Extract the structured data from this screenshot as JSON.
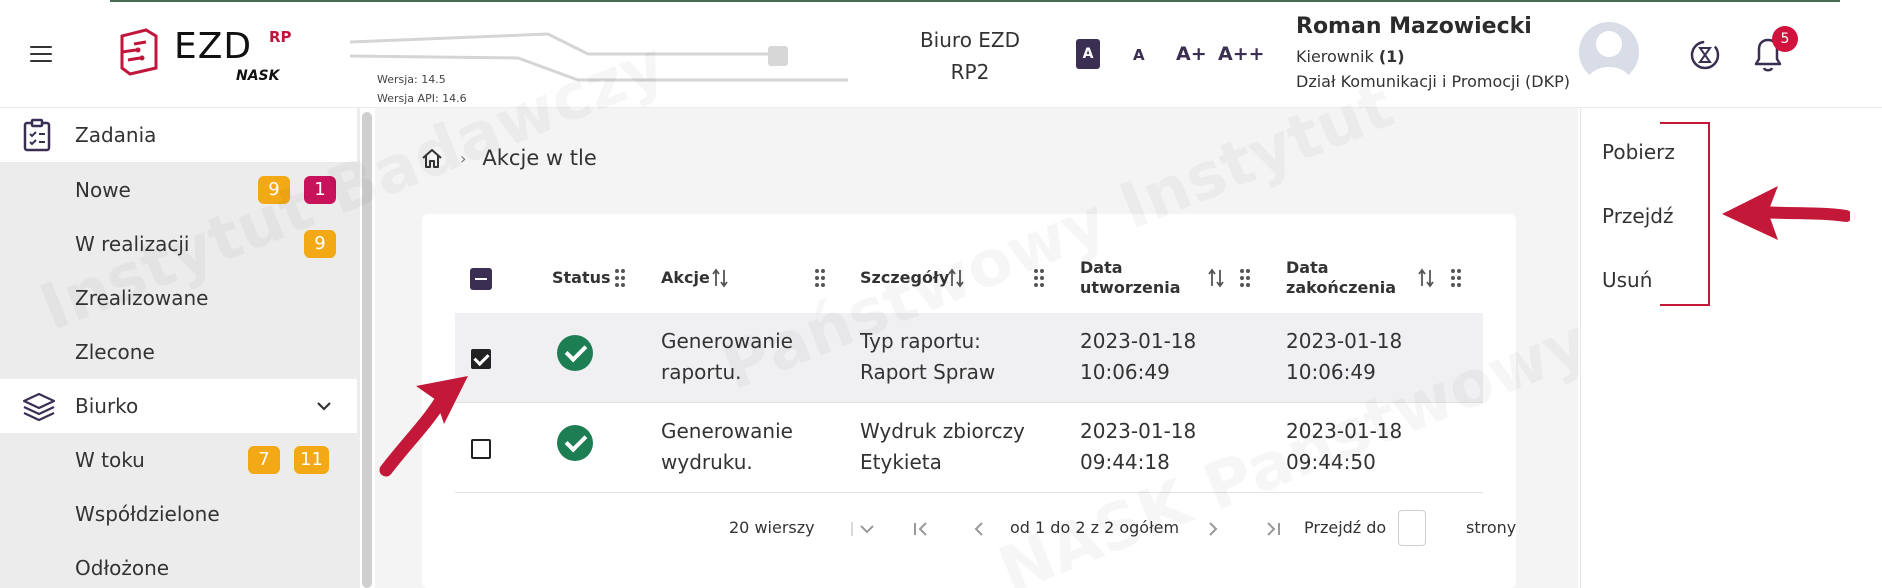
{
  "header": {
    "logo": {
      "name": "EZD",
      "sup": "RP",
      "sub": "NASK"
    },
    "version": "Wersja: 14.5",
    "api_version": "Wersja API: 14.6",
    "office_line1": "Biuro EZD",
    "office_line2": "RP2",
    "font_sizes": [
      "A",
      "A",
      "A+",
      "A++"
    ],
    "user_name": "Roman Mazowiecki",
    "user_role": "Kierownik",
    "user_role_count": "(1)",
    "user_dept": "Dział Komunikacji i Promocji (DKP)",
    "notifications": "5"
  },
  "sidebar": {
    "items": [
      {
        "label": "Zadania",
        "icon": "clipboard-icon"
      },
      {
        "label": "Nowe",
        "badges": [
          "9",
          "1"
        ]
      },
      {
        "label": "W realizacji",
        "badges": [
          "9"
        ]
      },
      {
        "label": "Zrealizowane"
      },
      {
        "label": "Zlecone"
      },
      {
        "label": "Biurko",
        "icon": "layers-icon"
      },
      {
        "label": "W toku",
        "badges": [
          "7",
          "11"
        ]
      },
      {
        "label": "Współdzielone"
      },
      {
        "label": "Odłożone"
      }
    ]
  },
  "breadcrumb": {
    "label": "Akcje w tle"
  },
  "table": {
    "headers": {
      "status": "Status",
      "akcje": "Akcje",
      "szczegoly": "Szczegóły",
      "data_utw_1": "Data",
      "data_utw_2": "utworzenia",
      "data_zak_1": "Data",
      "data_zak_2": "zakończenia"
    },
    "rows": [
      {
        "selected": true,
        "akcje_1": "Generowanie",
        "akcje_2": "raportu.",
        "szcz_1": "Typ raportu:",
        "szcz_2": "Raport Spraw",
        "utw_1": "2023-01-18",
        "utw_2": "10:06:49",
        "zak_1": "2023-01-18",
        "zak_2": "10:06:49"
      },
      {
        "selected": false,
        "akcje_1": "Generowanie",
        "akcje_2": "wydruku.",
        "szcz_1": "Wydruk zbiorczy",
        "szcz_2": "Etykieta",
        "utw_1": "2023-01-18",
        "utw_2": "09:44:18",
        "zak_1": "2023-01-18",
        "zak_2": "09:44:50"
      }
    ]
  },
  "pager": {
    "rows_per_page": "20 wierszy",
    "range": "od 1 do 2 z 2 ogółem",
    "goto_label": "Przejdź do",
    "goto_suffix": "strony"
  },
  "context_menu": {
    "items": [
      "Pobierz",
      "Przejdź",
      "Usuń"
    ]
  },
  "colors": {
    "accent": "#3a2f52",
    "badge_orange": "#f2a915",
    "badge_magenta": "#c8125c",
    "success": "#1d7e53",
    "annotation": "#c41838"
  }
}
